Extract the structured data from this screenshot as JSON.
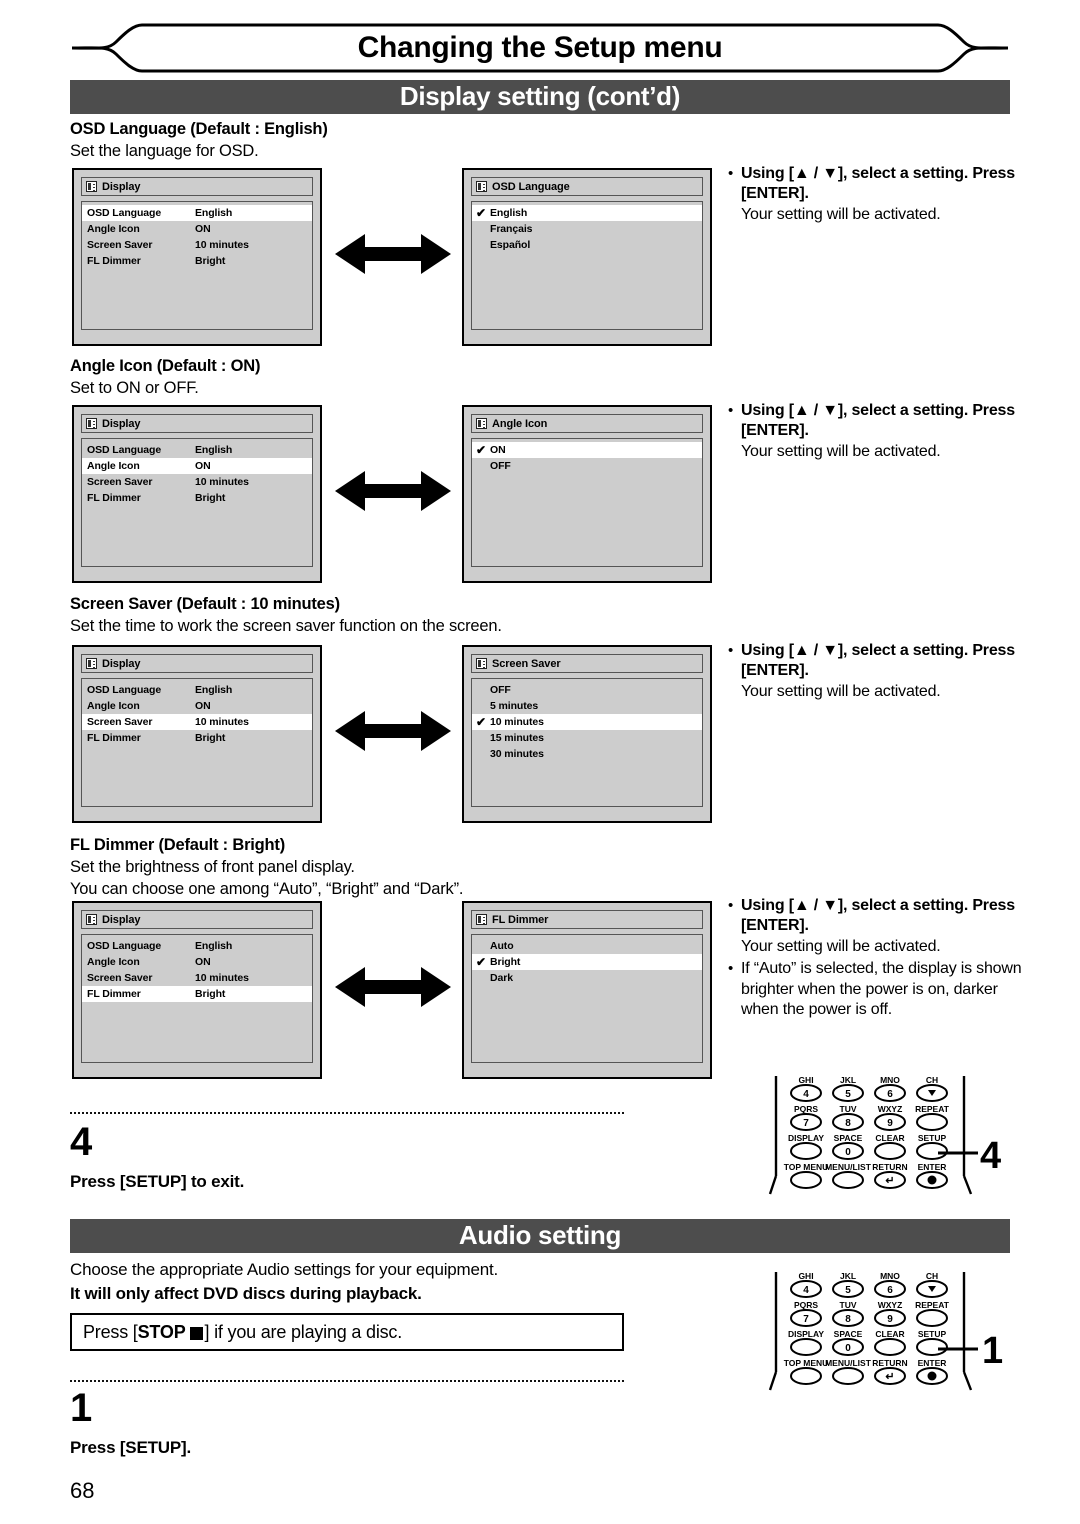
{
  "page": {
    "chapter_title": "Changing the Setup menu",
    "page_number": "68"
  },
  "bands": {
    "display_setting": "Display setting (cont’d)",
    "audio_setting": "Audio setting"
  },
  "sections": [
    {
      "id": "osd-language",
      "title": "OSD Language (Default : English)",
      "desc": "Set the language for OSD.",
      "left_panel": {
        "header": "Display",
        "rows": [
          {
            "label": "OSD Language",
            "value": "English",
            "selected": true
          },
          {
            "label": "Angle Icon",
            "value": "ON",
            "selected": false
          },
          {
            "label": "Screen Saver",
            "value": "10 minutes",
            "selected": false
          },
          {
            "label": "FL Dimmer",
            "value": "Bright",
            "selected": false
          }
        ]
      },
      "right_panel": {
        "header": "OSD Language",
        "options": [
          {
            "label": "English",
            "selected": true,
            "check": "✔"
          },
          {
            "label": "Français",
            "selected": false,
            "check": ""
          },
          {
            "label": "Español",
            "selected": false,
            "check": ""
          }
        ]
      },
      "notes": [
        {
          "bold": "Using [▲ / ▼], select a setting. Press [ENTER].",
          "plain": "Your setting will be activated."
        }
      ]
    },
    {
      "id": "angle-icon",
      "title": "Angle Icon (Default : ON)",
      "desc": "Set to ON or OFF.",
      "left_panel": {
        "header": "Display",
        "rows": [
          {
            "label": "OSD Language",
            "value": "English",
            "selected": false
          },
          {
            "label": "Angle Icon",
            "value": "ON",
            "selected": true
          },
          {
            "label": "Screen Saver",
            "value": "10 minutes",
            "selected": false
          },
          {
            "label": "FL Dimmer",
            "value": "Bright",
            "selected": false
          }
        ]
      },
      "right_panel": {
        "header": "Angle Icon",
        "options": [
          {
            "label": "ON",
            "selected": true,
            "check": "✔"
          },
          {
            "label": "OFF",
            "selected": false,
            "check": ""
          }
        ]
      },
      "notes": [
        {
          "bold": "Using [▲ / ▼], select a setting. Press [ENTER].",
          "plain": "Your setting will be activated."
        }
      ]
    },
    {
      "id": "screen-saver",
      "title": "Screen Saver (Default : 10 minutes)",
      "desc": "Set the time to work the screen saver function on the screen.",
      "left_panel": {
        "header": "Display",
        "rows": [
          {
            "label": "OSD Language",
            "value": "English",
            "selected": false
          },
          {
            "label": "Angle Icon",
            "value": "ON",
            "selected": false
          },
          {
            "label": "Screen Saver",
            "value": "10 minutes",
            "selected": true
          },
          {
            "label": "FL Dimmer",
            "value": "Bright",
            "selected": false
          }
        ]
      },
      "right_panel": {
        "header": "Screen Saver",
        "options": [
          {
            "label": "OFF",
            "selected": false,
            "check": ""
          },
          {
            "label": "5 minutes",
            "selected": false,
            "check": ""
          },
          {
            "label": "10 minutes",
            "selected": true,
            "check": "✔"
          },
          {
            "label": "15 minutes",
            "selected": false,
            "check": ""
          },
          {
            "label": "30 minutes",
            "selected": false,
            "check": ""
          }
        ]
      },
      "notes": [
        {
          "bold": "Using [▲ / ▼], select a setting. Press [ENTER].",
          "plain": "Your setting will be activated."
        }
      ]
    },
    {
      "id": "fl-dimmer",
      "title": "FL Dimmer (Default : Bright)",
      "desc": "Set the brightness of front panel display.",
      "desc2": "You can choose one among “Auto”, “Bright” and “Dark”.",
      "left_panel": {
        "header": "Display",
        "rows": [
          {
            "label": "OSD Language",
            "value": "English",
            "selected": false
          },
          {
            "label": "Angle Icon",
            "value": "ON",
            "selected": false
          },
          {
            "label": "Screen Saver",
            "value": "10 minutes",
            "selected": false
          },
          {
            "label": "FL Dimmer",
            "value": "Bright",
            "selected": true
          }
        ]
      },
      "right_panel": {
        "header": "FL Dimmer",
        "options": [
          {
            "label": "Auto",
            "selected": false,
            "check": ""
          },
          {
            "label": "Bright",
            "selected": true,
            "check": "✔"
          },
          {
            "label": "Dark",
            "selected": false,
            "check": ""
          }
        ]
      },
      "notes": [
        {
          "bold": "Using [▲ / ▼], select a setting. Press [ENTER].",
          "plain": "Your setting will be activated."
        },
        {
          "bold": "",
          "plain": "If “Auto” is selected, the display is shown brighter when the power is on, darker when the power is off."
        }
      ]
    }
  ],
  "steps": {
    "step4": {
      "number": "4",
      "text": "Press [SETUP] to exit."
    },
    "step1": {
      "number": "1",
      "text": "Press [SETUP]."
    }
  },
  "audio": {
    "line1": "Choose the appropriate Audio settings for your equipment.",
    "line2": "It will only affect DVD discs during playback.",
    "boxnote_pre": "Press [",
    "boxnote_bold": "STOP",
    "boxnote_post": "] if you are playing a disc."
  },
  "remote": {
    "callout_top": "4",
    "callout_bottom": "1",
    "keys": [
      {
        "caption": "GHI",
        "digit": "4",
        "shape": "round"
      },
      {
        "caption": "JKL",
        "digit": "5",
        "shape": "round"
      },
      {
        "caption": "MNO",
        "digit": "6",
        "shape": "round"
      },
      {
        "caption": "CH",
        "digit": "▼",
        "shape": "round"
      },
      {
        "caption": "PQRS",
        "digit": "7",
        "shape": "round"
      },
      {
        "caption": "TUV",
        "digit": "8",
        "shape": "round"
      },
      {
        "caption": "WXYZ",
        "digit": "9",
        "shape": "round"
      },
      {
        "caption": "REPEAT",
        "digit": "",
        "shape": "oval"
      },
      {
        "caption": "DISPLAY",
        "digit": "",
        "shape": "oval"
      },
      {
        "caption": "SPACE",
        "digit": "0",
        "shape": "round"
      },
      {
        "caption": "CLEAR",
        "digit": "",
        "shape": "oval"
      },
      {
        "caption": "SETUP",
        "digit": "",
        "shape": "oval"
      },
      {
        "caption": "TOP MENU",
        "digit": "",
        "shape": "oval"
      },
      {
        "caption": "MENU/LIST",
        "digit": "",
        "shape": "oval"
      },
      {
        "caption": "RETURN",
        "digit": "↵",
        "shape": "round"
      },
      {
        "caption": "ENTER",
        "digit": "●",
        "shape": "round"
      }
    ]
  },
  "colors": {
    "band_bg": "#4d4d4d",
    "osd_bg": "#cdcdcd",
    "osd_selected": "#ffffff"
  }
}
